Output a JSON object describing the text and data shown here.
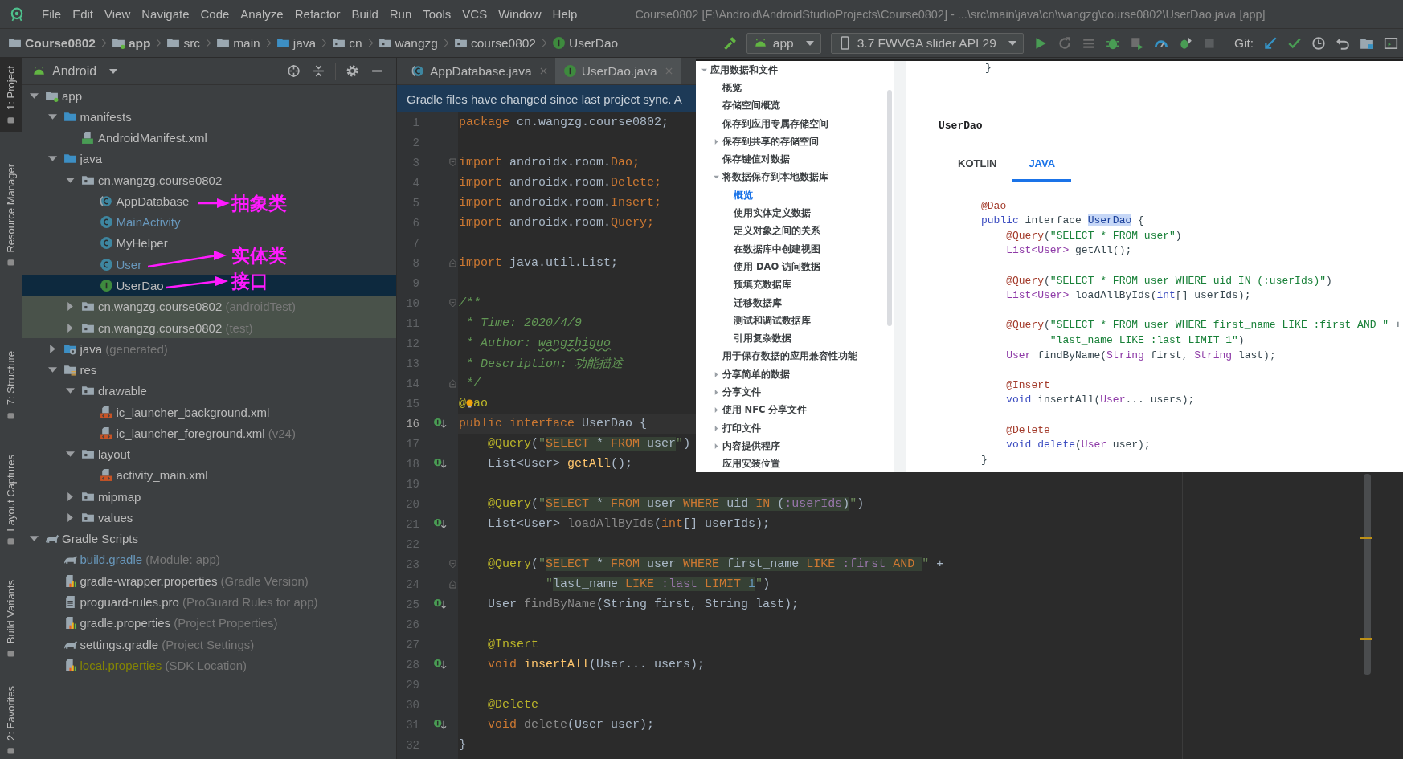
{
  "menu_bar": {
    "items": [
      "File",
      "Edit",
      "View",
      "Navigate",
      "Code",
      "Analyze",
      "Refactor",
      "Build",
      "Run",
      "Tools",
      "VCS",
      "Window",
      "Help"
    ],
    "title": "Course0802 [F:\\Android\\AndroidStudioProjects\\Course0802] - ...\\src\\main\\java\\cn\\wangzg\\course0802\\UserDao.java [app]"
  },
  "nav_bar": {
    "breadcrumbs": [
      {
        "label": "Course0802",
        "kind": "project"
      },
      {
        "label": "app",
        "kind": "module"
      },
      {
        "label": "src",
        "kind": "folder"
      },
      {
        "label": "main",
        "kind": "folder"
      },
      {
        "label": "java",
        "kind": "source_folder"
      },
      {
        "label": "cn",
        "kind": "package"
      },
      {
        "label": "wangzg",
        "kind": "package"
      },
      {
        "label": "course0802",
        "kind": "package"
      },
      {
        "label": "UserDao",
        "kind": "interface"
      }
    ],
    "run_config": "app",
    "device": "3.7  FWVGA slider API 29",
    "git_label": "Git:"
  },
  "tool_stripe": [
    {
      "label": "1: Project",
      "selected": true
    },
    {
      "label": "Resource Manager",
      "selected": false
    },
    {
      "label": "7: Structure",
      "selected": false
    },
    {
      "label": "Layout Captures",
      "selected": false
    },
    {
      "label": "Build Variants",
      "selected": false
    },
    {
      "label": "2: Favorites",
      "selected": false
    }
  ],
  "project": {
    "view": "Android",
    "tree": [
      {
        "label": "app",
        "kind": "module",
        "expanded": true,
        "selected": false,
        "children": [
          {
            "label": "manifests",
            "kind": "source_folder",
            "expanded": true,
            "selected": false,
            "children": [
              {
                "label": "AndroidManifest.xml",
                "kind": "manifest",
                "selected": false
              }
            ]
          },
          {
            "label": "java",
            "kind": "source_folder",
            "expanded": true,
            "selected": false,
            "children": [
              {
                "label": "cn.wangzg.course0802",
                "kind": "package",
                "expanded": true,
                "selected": false,
                "children": [
                  {
                    "label": "AppDatabase",
                    "kind": "abstract_class",
                    "selected": false
                  },
                  {
                    "label": "MainActivity",
                    "kind": "class",
                    "color": "#6897bb",
                    "selected": false
                  },
                  {
                    "label": "MyHelper",
                    "kind": "class",
                    "selected": false
                  },
                  {
                    "label": "User",
                    "kind": "class",
                    "color": "#6897bb",
                    "selected": false
                  },
                  {
                    "label": "UserDao",
                    "kind": "interface",
                    "selected": true
                  }
                ]
              },
              {
                "label": "cn.wangzg.course0802",
                "suffix": "(androidTest)",
                "kind": "test_package",
                "expanded": false,
                "selected": false
              },
              {
                "label": "cn.wangzg.course0802",
                "suffix": "(test)",
                "kind": "test_package",
                "expanded": false,
                "selected": false
              }
            ]
          },
          {
            "label": "java",
            "suffix": "(generated)",
            "kind": "generated_folder",
            "expanded": false,
            "selected": false
          },
          {
            "label": "res",
            "kind": "res_folder",
            "expanded": true,
            "selected": false,
            "children": [
              {
                "label": "drawable",
                "kind": "package",
                "expanded": true,
                "selected": false,
                "children": [
                  {
                    "label": "ic_launcher_background.xml",
                    "kind": "xml",
                    "selected": false
                  },
                  {
                    "label": "ic_launcher_foreground.xml",
                    "suffix": "(v24)",
                    "kind": "xml",
                    "selected": false
                  }
                ]
              },
              {
                "label": "layout",
                "kind": "package",
                "expanded": true,
                "selected": false,
                "children": [
                  {
                    "label": "activity_main.xml",
                    "kind": "xml",
                    "selected": false
                  }
                ]
              },
              {
                "label": "mipmap",
                "kind": "package",
                "expanded": false,
                "selected": false
              },
              {
                "label": "values",
                "kind": "package",
                "expanded": false,
                "selected": false
              }
            ]
          }
        ]
      },
      {
        "label": "Gradle Scripts",
        "kind": "gradle_root",
        "expanded": true,
        "selected": false,
        "children": [
          {
            "label": "build.gradle",
            "suffix": "(Module: app)",
            "kind": "gradle",
            "color": "#6897bb",
            "selected": false
          },
          {
            "label": "gradle-wrapper.properties",
            "suffix": "(Gradle Version)",
            "kind": "properties",
            "selected": false
          },
          {
            "label": "proguard-rules.pro",
            "suffix": "(ProGuard Rules for app)",
            "kind": "pro_file",
            "selected": false
          },
          {
            "label": "gradle.properties",
            "suffix": "(Project Properties)",
            "kind": "properties",
            "selected": false
          },
          {
            "label": "settings.gradle",
            "suffix": "(Project Settings)",
            "kind": "gradle",
            "selected": false
          },
          {
            "label": "local.properties",
            "suffix": "(SDK Location)",
            "kind": "properties",
            "color": "#848504",
            "selected": false
          }
        ]
      }
    ],
    "annotations": [
      {
        "text": "抽象类"
      },
      {
        "text": "实体类"
      },
      {
        "text": "接口"
      }
    ]
  },
  "editor": {
    "tabs": [
      {
        "label": "AppDatabase.java",
        "kind": "abstract_class",
        "selected": false
      },
      {
        "label": "UserDao.java",
        "kind": "interface",
        "selected": true
      }
    ],
    "banner": "Gradle files have changed since last project sync. A",
    "lines": [
      {
        "no": "1",
        "kind": "plain",
        "current": false,
        "segments": [
          {
            "text": "package",
            "kind": "kw"
          },
          {
            "text": " cn.wangzg.course0802;",
            "kind": "plain"
          }
        ]
      },
      {
        "no": "2",
        "kind": "plain",
        "current": false
      },
      {
        "no": "3",
        "kind": "fold_start",
        "current": false,
        "segments": [
          {
            "text": "import",
            "kind": "kw"
          },
          {
            "text": " androidx.room.",
            "kind": "plain"
          },
          {
            "text": "Dao;",
            "kind": "kw"
          }
        ]
      },
      {
        "no": "4",
        "kind": "plain",
        "current": false,
        "segments": [
          {
            "text": "import",
            "kind": "kw"
          },
          {
            "text": " androidx.room.",
            "kind": "plain"
          },
          {
            "text": "Delete;",
            "kind": "kw"
          }
        ]
      },
      {
        "no": "5",
        "kind": "plain",
        "current": false,
        "segments": [
          {
            "text": "import",
            "kind": "kw"
          },
          {
            "text": " androidx.room.",
            "kind": "plain"
          },
          {
            "text": "Insert;",
            "kind": "kw"
          }
        ]
      },
      {
        "no": "6",
        "kind": "plain",
        "current": false,
        "segments": [
          {
            "text": "import",
            "kind": "kw"
          },
          {
            "text": " androidx.room.",
            "kind": "plain"
          },
          {
            "text": "Query;",
            "kind": "kw"
          }
        ]
      },
      {
        "no": "7",
        "kind": "plain",
        "current": false
      },
      {
        "no": "8",
        "kind": "fold_end",
        "current": false,
        "segments": [
          {
            "text": "import",
            "kind": "kw"
          },
          {
            "text": " java.util.List;",
            "kind": "plain"
          }
        ]
      },
      {
        "no": "9",
        "kind": "plain",
        "current": false
      },
      {
        "no": "10",
        "kind": "fold_start",
        "current": false,
        "segments": [
          {
            "text": "/**",
            "kind": "comment"
          }
        ]
      },
      {
        "no": "11",
        "kind": "plain",
        "current": false,
        "segments": [
          {
            "text": " * Time: 2020/4/9",
            "kind": "comment"
          }
        ]
      },
      {
        "no": "12",
        "kind": "plain",
        "current": false,
        "segments": [
          {
            "text": " * Author: ",
            "kind": "comment"
          },
          {
            "text": "wangzhiguo",
            "kind": "typo"
          }
        ]
      },
      {
        "no": "13",
        "kind": "plain",
        "current": false,
        "segments": [
          {
            "text": " * Description: 功能描述",
            "kind": "comment"
          }
        ]
      },
      {
        "no": "14",
        "kind": "fold_end",
        "current": false,
        "segments": [
          {
            "text": " */",
            "kind": "comment"
          }
        ]
      },
      {
        "no": "15",
        "kind": "plain",
        "current": false,
        "segments": [
          {
            "text": "@",
            "kind": "ann"
          },
          {
            "kind": "bulb"
          },
          {
            "text": "ao",
            "kind": "ann"
          }
        ]
      },
      {
        "no": "16",
        "kind": "implements",
        "current": true,
        "segments": [
          {
            "text": "public interface",
            "kind": "kw"
          },
          {
            "text": " UserDao {",
            "kind": "plain"
          }
        ]
      },
      {
        "no": "17",
        "kind": "plain",
        "current": false,
        "segments": [
          {
            "text": "    @Query",
            "kind": "ann"
          },
          {
            "text": "(",
            "kind": "plain"
          },
          {
            "text": "\"",
            "kind": "str"
          },
          {
            "text": "SELECT",
            "kind": "sqlkw"
          },
          {
            "text": " * ",
            "kind": "sqlid"
          },
          {
            "text": "FROM",
            "kind": "sqlkw"
          },
          {
            "text": " user",
            "kind": "sqlid"
          },
          {
            "text": "\"",
            "kind": "str"
          },
          {
            "text": ")",
            "kind": "plain"
          }
        ]
      },
      {
        "no": "18",
        "kind": "implements",
        "current": false,
        "segments": [
          {
            "text": "    List<User> ",
            "kind": "plain"
          },
          {
            "text": "getAll",
            "kind": "method"
          },
          {
            "text": "();",
            "kind": "plain"
          }
        ]
      },
      {
        "no": "19",
        "kind": "plain",
        "current": false
      },
      {
        "no": "20",
        "kind": "plain",
        "current": false,
        "segments": [
          {
            "text": "    @Query",
            "kind": "ann"
          },
          {
            "text": "(",
            "kind": "plain"
          },
          {
            "text": "\"",
            "kind": "str"
          },
          {
            "text": "SELECT",
            "kind": "sqlkw"
          },
          {
            "text": " * ",
            "kind": "sqlid"
          },
          {
            "text": "FROM",
            "kind": "sqlkw"
          },
          {
            "text": " user ",
            "kind": "sqlid"
          },
          {
            "text": "WHERE",
            "kind": "sqlkw"
          },
          {
            "text": " uid ",
            "kind": "sqlid"
          },
          {
            "text": "IN",
            "kind": "sqlkw"
          },
          {
            "text": " (",
            "kind": "sqlid"
          },
          {
            "text": ":userIds",
            "kind": "sqlparam"
          },
          {
            "text": ")",
            "kind": "sqlid"
          },
          {
            "text": "\"",
            "kind": "str"
          },
          {
            "text": ")",
            "kind": "plain"
          }
        ]
      },
      {
        "no": "21",
        "kind": "implements",
        "current": false,
        "segments": [
          {
            "text": "    List<User> ",
            "kind": "plain"
          },
          {
            "text": "loadAllByIds",
            "kind": "muted"
          },
          {
            "text": "(",
            "kind": "plain"
          },
          {
            "text": "int",
            "kind": "kw"
          },
          {
            "text": "[] userIds);",
            "kind": "plain"
          }
        ]
      },
      {
        "no": "22",
        "kind": "plain",
        "current": false
      },
      {
        "no": "23",
        "kind": "fold_start",
        "current": false,
        "segments": [
          {
            "text": "    @Query",
            "kind": "ann"
          },
          {
            "text": "(",
            "kind": "plain"
          },
          {
            "text": "\"",
            "kind": "str"
          },
          {
            "text": "SELECT",
            "kind": "sqlkw"
          },
          {
            "text": " * ",
            "kind": "sqlid"
          },
          {
            "text": "FROM",
            "kind": "sqlkw"
          },
          {
            "text": " user ",
            "kind": "sqlid"
          },
          {
            "text": "WHERE",
            "kind": "sqlkw"
          },
          {
            "text": " first_name ",
            "kind": "sqlid"
          },
          {
            "text": "LIKE",
            "kind": "sqlkw"
          },
          {
            "text": " :first ",
            "kind": "sqlparam"
          },
          {
            "text": "AND ",
            "kind": "sqlkw"
          },
          {
            "text": "\"",
            "kind": "str"
          },
          {
            "text": " +",
            "kind": "plain"
          }
        ]
      },
      {
        "no": "24",
        "kind": "fold_end",
        "current": false,
        "segments": [
          {
            "text": "            \"",
            "kind": "str"
          },
          {
            "text": "last_name ",
            "kind": "sqlid"
          },
          {
            "text": "LIKE",
            "kind": "sqlkw"
          },
          {
            "text": " :last ",
            "kind": "sqlparam"
          },
          {
            "text": "LIMIT",
            "kind": "sqlkw"
          },
          {
            "text": " 1",
            "kind": "sqlnum"
          },
          {
            "text": "\"",
            "kind": "str"
          },
          {
            "text": ")",
            "kind": "plain"
          }
        ]
      },
      {
        "no": "25",
        "kind": "implements",
        "current": false,
        "segments": [
          {
            "text": "    User ",
            "kind": "plain"
          },
          {
            "text": "findByName",
            "kind": "muted"
          },
          {
            "text": "(String first, String last);",
            "kind": "plain"
          }
        ]
      },
      {
        "no": "26",
        "kind": "plain",
        "current": false
      },
      {
        "no": "27",
        "kind": "plain",
        "current": false,
        "segments": [
          {
            "text": "    @Insert",
            "kind": "ann"
          }
        ]
      },
      {
        "no": "28",
        "kind": "implements",
        "current": false,
        "segments": [
          {
            "text": "    void",
            "kind": "kw"
          },
          {
            "text": " insertAll",
            "kind": "method"
          },
          {
            "text": "(User... users);",
            "kind": "plain"
          }
        ]
      },
      {
        "no": "29",
        "kind": "plain",
        "current": false
      },
      {
        "no": "30",
        "kind": "plain",
        "current": false,
        "segments": [
          {
            "text": "    @Delete",
            "kind": "ann"
          }
        ]
      },
      {
        "no": "31",
        "kind": "implements",
        "current": false,
        "segments": [
          {
            "text": "    void",
            "kind": "kw"
          },
          {
            "text": " delete",
            "kind": "muted"
          },
          {
            "text": "(User user);",
            "kind": "plain"
          }
        ]
      },
      {
        "no": "32",
        "kind": "plain",
        "current": false,
        "segments": [
          {
            "text": "}",
            "kind": "plain"
          }
        ]
      }
    ]
  },
  "doc_overlay": {
    "nav": [
      {
        "label": "应用数据和文件",
        "expanded": true,
        "selected": false,
        "children": [
          {
            "label": "概览",
            "selected": false
          },
          {
            "label": "存储空间概览",
            "selected": false
          },
          {
            "label": "保存到应用专属存储空间",
            "selected": false
          },
          {
            "label": "保存到共享的存储空间",
            "expanded": false,
            "selected": false
          },
          {
            "label": "保存键值对数据",
            "selected": false
          },
          {
            "label": "将数据保存到本地数据库",
            "expanded": true,
            "selected": false,
            "children": [
              {
                "label": "概览",
                "selected": true
              },
              {
                "label": "使用实体定义数据",
                "selected": false
              },
              {
                "label": "定义对象之间的关系",
                "selected": false
              },
              {
                "label": "在数据库中创建视图",
                "selected": false
              },
              {
                "label": "使用 DAO 访问数据",
                "selected": false
              },
              {
                "label": "预填充数据库",
                "selected": false
              },
              {
                "label": "迁移数据库",
                "selected": false
              },
              {
                "label": "测试和调试数据库",
                "selected": false
              },
              {
                "label": "引用复杂数据",
                "selected": false
              }
            ]
          },
          {
            "label": "用于保存数据的应用兼容性功能",
            "selected": false
          },
          {
            "label": "分享简单的数据",
            "expanded": false,
            "selected": false
          },
          {
            "label": "分享文件",
            "expanded": false,
            "selected": false
          },
          {
            "label": "使用 NFC 分享文件",
            "expanded": false,
            "selected": false
          },
          {
            "label": "打印文件",
            "expanded": false,
            "selected": false
          },
          {
            "label": "内容提供程序",
            "expanded": false,
            "selected": false
          },
          {
            "label": "应用安装位置",
            "selected": false
          }
        ]
      }
    ],
    "top_code": "}",
    "heading": "UserDao",
    "tabs": [
      {
        "label": "KOTLIN",
        "selected": false
      },
      {
        "label": "JAVA",
        "selected": true
      }
    ],
    "code": [
      {
        "kind": "code",
        "segments": [
          {
            "text": "@Dao",
            "kind": "ann"
          }
        ]
      },
      {
        "kind": "code",
        "segments": [
          {
            "text": "public",
            "kind": "kw"
          },
          {
            "text": " interface ",
            "kind": "plain"
          },
          {
            "text": "UserDao",
            "kind": "sel"
          },
          {
            "text": " {",
            "kind": "plain"
          }
        ]
      },
      {
        "kind": "code",
        "segments": [
          {
            "text": "    @Query",
            "kind": "ann"
          },
          {
            "text": "(",
            "kind": "plain"
          },
          {
            "text": "\"SELECT * FROM user\"",
            "kind": "str"
          },
          {
            "text": ")",
            "kind": "plain"
          }
        ]
      },
      {
        "kind": "code",
        "segments": [
          {
            "text": "    List<User>",
            "kind": "type"
          },
          {
            "text": " getAll();",
            "kind": "plain"
          }
        ]
      },
      {
        "kind": "blank"
      },
      {
        "kind": "code",
        "segments": [
          {
            "text": "    @Query",
            "kind": "ann"
          },
          {
            "text": "(",
            "kind": "plain"
          },
          {
            "text": "\"SELECT * FROM user WHERE uid IN (:userIds)\"",
            "kind": "str"
          },
          {
            "text": ")",
            "kind": "plain"
          }
        ]
      },
      {
        "kind": "code",
        "segments": [
          {
            "text": "    List<User>",
            "kind": "type"
          },
          {
            "text": " loadAllByIds(",
            "kind": "plain"
          },
          {
            "text": "int",
            "kind": "kw"
          },
          {
            "text": "[] userIds);",
            "kind": "plain"
          }
        ]
      },
      {
        "kind": "blank"
      },
      {
        "kind": "code",
        "segments": [
          {
            "text": "    @Query",
            "kind": "ann"
          },
          {
            "text": "(",
            "kind": "plain"
          },
          {
            "text": "\"SELECT * FROM user WHERE first_name LIKE :first AND \"",
            "kind": "str"
          },
          {
            "text": " +",
            "kind": "plain"
          }
        ]
      },
      {
        "kind": "code",
        "segments": [
          {
            "text": "           \"last_name LIKE :last LIMIT 1\"",
            "kind": "str"
          },
          {
            "text": ")",
            "kind": "plain"
          }
        ]
      },
      {
        "kind": "code",
        "segments": [
          {
            "text": "    User",
            "kind": "type"
          },
          {
            "text": " findByName(",
            "kind": "plain"
          },
          {
            "text": "String",
            "kind": "type"
          },
          {
            "text": " first, ",
            "kind": "plain"
          },
          {
            "text": "String",
            "kind": "type"
          },
          {
            "text": " last);",
            "kind": "plain"
          }
        ]
      },
      {
        "kind": "blank"
      },
      {
        "kind": "code",
        "segments": [
          {
            "text": "    @Insert",
            "kind": "ann"
          }
        ]
      },
      {
        "kind": "code",
        "segments": [
          {
            "text": "    void",
            "kind": "kw"
          },
          {
            "text": " insertAll(",
            "kind": "plain"
          },
          {
            "text": "User",
            "kind": "type"
          },
          {
            "text": "... users);",
            "kind": "plain"
          }
        ]
      },
      {
        "kind": "blank"
      },
      {
        "kind": "code",
        "segments": [
          {
            "text": "    @Delete",
            "kind": "ann"
          }
        ]
      },
      {
        "kind": "code",
        "segments": [
          {
            "text": "    void delete",
            "kind": "kw"
          },
          {
            "text": "(",
            "kind": "plain"
          },
          {
            "text": "User",
            "kind": "type"
          },
          {
            "text": " user);",
            "kind": "plain"
          }
        ]
      },
      {
        "kind": "code",
        "segments": [
          {
            "text": "}",
            "kind": "plain"
          }
        ]
      }
    ]
  }
}
